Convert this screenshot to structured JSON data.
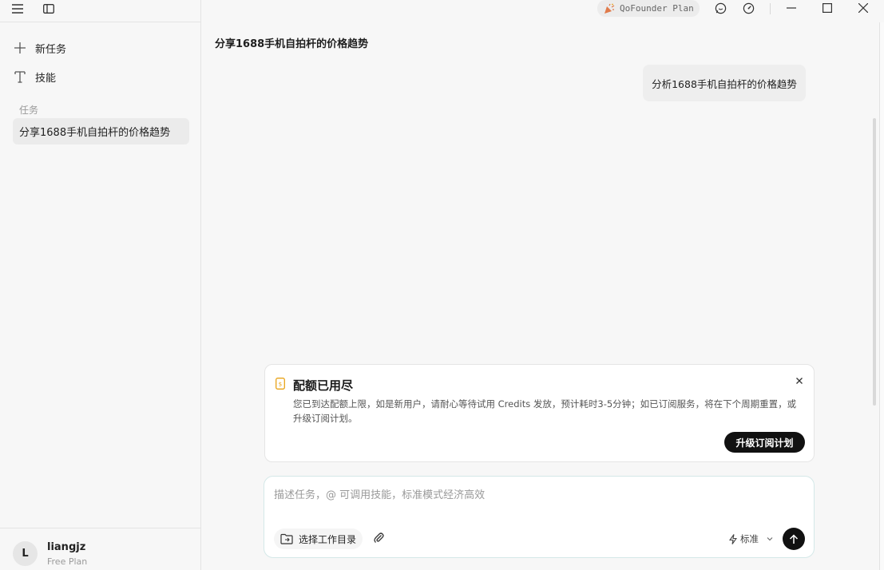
{
  "titlebar": {
    "plan_pill": "QoFounder Plan"
  },
  "sidebar": {
    "nav": [
      {
        "label": "新任务",
        "icon": "plus-icon"
      },
      {
        "label": "技能",
        "icon": "skill-icon"
      }
    ],
    "section_label": "任务",
    "tasks": [
      {
        "label": "分享1688手机自拍杆的价格趋势"
      }
    ],
    "user": {
      "initial": "L",
      "name": "liangjz",
      "plan": "Free Plan"
    }
  },
  "main": {
    "title": "分享1688手机自拍杆的价格趋势",
    "messages": [
      {
        "role": "user",
        "text": "分析1688手机自拍杆的价格趋势"
      }
    ]
  },
  "quota": {
    "title": "配额已用尽",
    "description": "您已到达配额上限，如是新用户，请耐心等待试用 Credits 发放，预计耗时3-5分钟；如已订阅服务，将在下个周期重置，或升级订阅计划。",
    "upgrade_label": "升级订阅计划"
  },
  "composer": {
    "placeholder": "描述任务，@ 可调用技能，标准模式经济高效",
    "dir_label": "选择工作目录",
    "mode_label": "标准"
  },
  "colors": {
    "accent": "#111111",
    "pill_icon": "#e07a4a",
    "quota_icon": "#e8a317"
  }
}
